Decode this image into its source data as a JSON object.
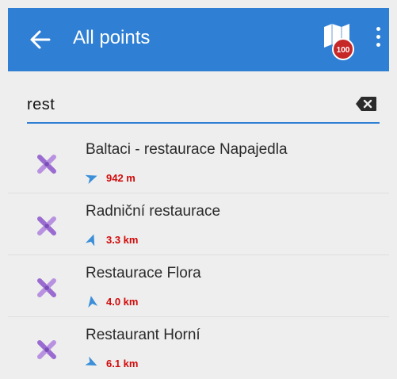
{
  "appbar": {
    "title": "All points",
    "color": "#2f7fd4",
    "back_icon": "arrow-left-icon",
    "map_icon": "map-badge-icon",
    "map_badge_text": "100",
    "more_icon": "more-vertical-icon"
  },
  "search": {
    "value": "rest",
    "clear_icon": "backspace-icon"
  },
  "results": [
    {
      "name": "Baltaci - restaurace Napajedla",
      "distance": "942 m",
      "icon": "poi-tools-icon",
      "arrow_rotation_deg": 70
    },
    {
      "name": "Radniční restaurace",
      "distance": "3.3 km",
      "icon": "poi-tools-icon",
      "arrow_rotation_deg": 20
    },
    {
      "name": "Restaurace Flora",
      "distance": "4.0 km",
      "icon": "poi-tools-icon",
      "arrow_rotation_deg": -10
    },
    {
      "name": "Restaurant Horní",
      "distance": "6.1 km",
      "icon": "poi-tools-icon",
      "arrow_rotation_deg": 115
    }
  ],
  "colors": {
    "accent": "#2f7fd4",
    "distance": "#d10b0b",
    "poi_icon": "#9a6bd0",
    "direction_arrow": "#3b8fd9"
  }
}
